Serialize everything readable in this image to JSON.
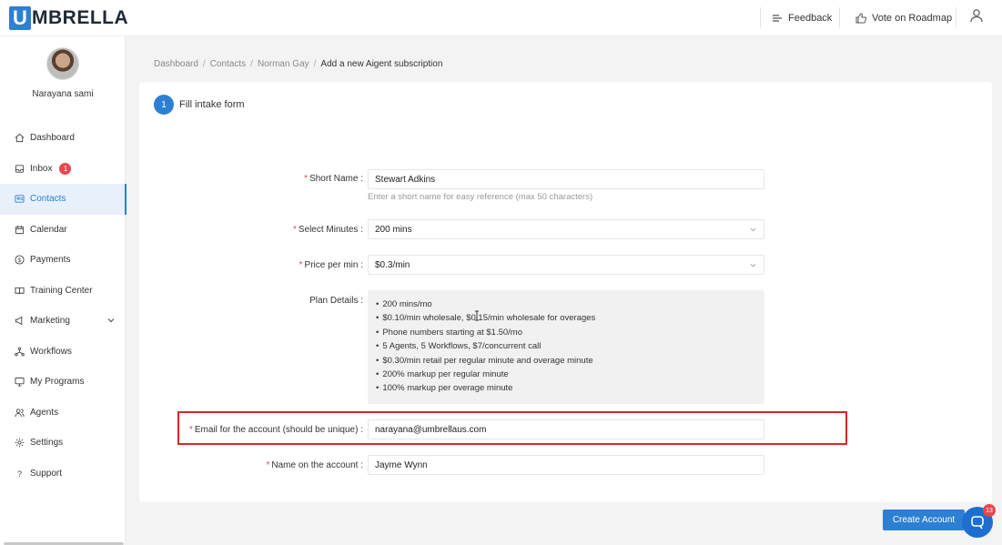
{
  "brand": {
    "logo_letter": "U",
    "logo_text": "MBRELLA"
  },
  "topbar": {
    "feedback": "Feedback",
    "vote": "Vote on Roadmap"
  },
  "user": {
    "name": "Narayana sami"
  },
  "sidebar": {
    "items": [
      {
        "label": "Dashboard",
        "icon": "home-icon"
      },
      {
        "label": "Inbox",
        "icon": "inbox-icon",
        "badge": "1"
      },
      {
        "label": "Contacts",
        "icon": "contact-card-icon"
      },
      {
        "label": "Calendar",
        "icon": "calendar-icon"
      },
      {
        "label": "Payments",
        "icon": "dollar-icon"
      },
      {
        "label": "Training Center",
        "icon": "book-icon"
      },
      {
        "label": "Marketing",
        "icon": "megaphone-icon"
      },
      {
        "label": "Workflows",
        "icon": "workflow-icon"
      },
      {
        "label": "My Programs",
        "icon": "monitor-icon"
      },
      {
        "label": "Agents",
        "icon": "agents-icon"
      },
      {
        "label": "Settings",
        "icon": "gear-icon"
      },
      {
        "label": "Support",
        "icon": "question-icon"
      }
    ],
    "active": "Contacts"
  },
  "breadcrumb": {
    "b1": "Dashboard",
    "b2": "Contacts",
    "b3": "Norman Gay",
    "current": "Add a new Aigent subscription"
  },
  "step": {
    "number": "1",
    "title": "Fill intake form"
  },
  "form": {
    "short_name": {
      "label": "Short Name",
      "value": "Stewart Adkins",
      "help": "Enter a short name for easy reference (max 50 characters)"
    },
    "minutes": {
      "label": "Select Minutes",
      "value": "200 mins"
    },
    "price": {
      "label": "Price per min",
      "value": "$0.3/min"
    },
    "plan": {
      "label": "Plan Details",
      "items": [
        "200 mins/mo",
        "$0.10/min wholesale, $0.15/min wholesale for overages",
        "Phone numbers starting at $1.50/mo",
        "5 Agents, 5 Workflows, $7/concurrent call",
        "$0.30/min retail per regular minute and overage minute",
        "200% markup per regular minute",
        "100% markup per overage minute"
      ]
    },
    "email": {
      "label": "Email for the account (should be unique)",
      "value": "narayana@umbrellaus.com"
    },
    "account_name": {
      "label": "Name on the account",
      "value": "Jayme Wynn"
    }
  },
  "actions": {
    "create": "Create Account"
  },
  "chat": {
    "badge": "13"
  },
  "colors": {
    "accent": "#2d7fd2",
    "highlight": "#d9252a",
    "badge": "#e5484d"
  }
}
